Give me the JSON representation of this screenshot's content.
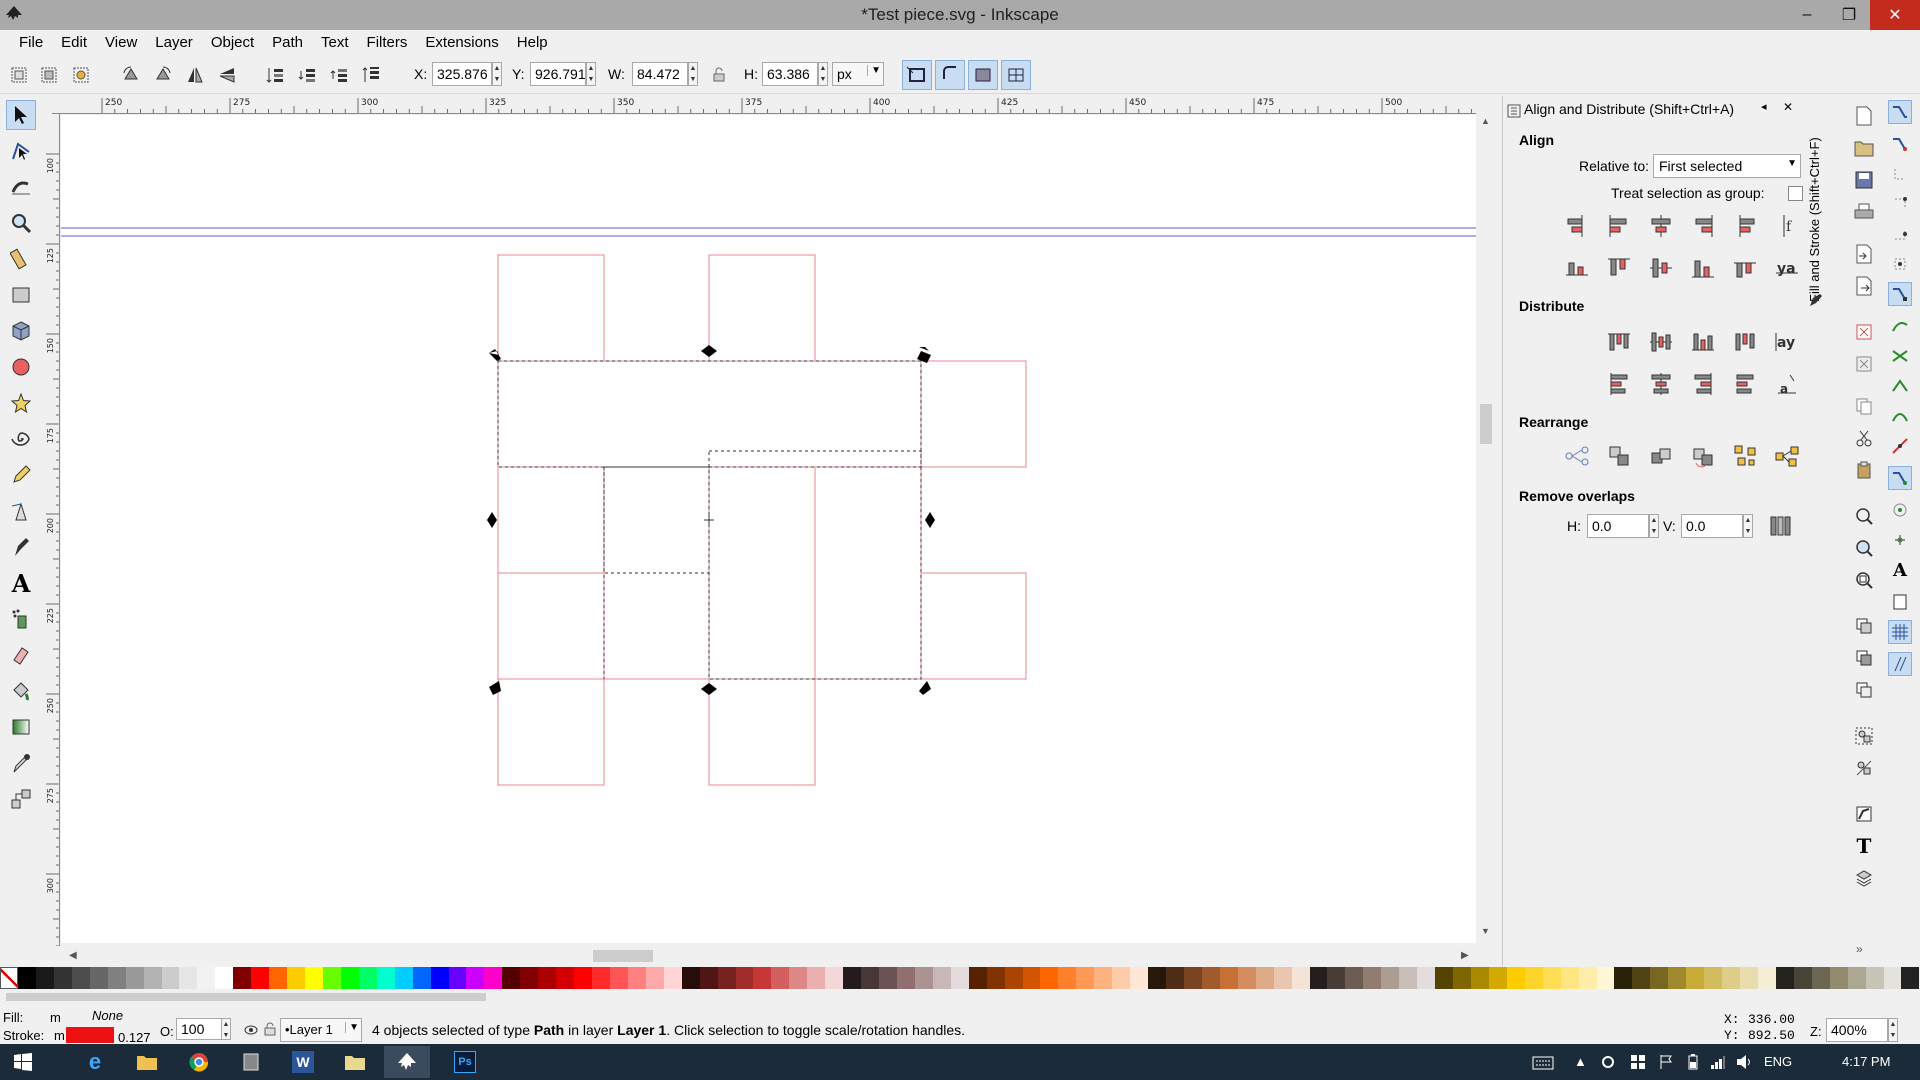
{
  "window": {
    "title": "*Test piece.svg - Inkscape",
    "minimize": "–",
    "maximize": "❐",
    "close": "✕"
  },
  "menu": [
    "File",
    "Edit",
    "View",
    "Layer",
    "Object",
    "Path",
    "Text",
    "Filters",
    "Extensions",
    "Help"
  ],
  "controls": {
    "x_label": "X:",
    "x_value": "325.876",
    "y_label": "Y:",
    "y_value": "926.791",
    "w_label": "W:",
    "w_value": "84.472",
    "h_label": "H:",
    "h_value": "63.386",
    "unit": "px"
  },
  "rulers": {
    "h_ticks": [
      "250",
      "275",
      "300",
      "325",
      "350",
      "375",
      "400",
      "425",
      "450",
      "475",
      "500"
    ],
    "v_ticks": [
      "100",
      "125",
      "150",
      "175",
      "200",
      "225",
      "250",
      "275",
      "300"
    ]
  },
  "dock": {
    "title": "Align and Distribute (Shift+Ctrl+A)",
    "vertical_tab": "Fill and Stroke (Shift+Ctrl+F)",
    "align": {
      "heading": "Align",
      "relative_label": "Relative to:",
      "relative_value": "First selected",
      "treat_group_label": "Treat selection as group:",
      "treat_group_checked": false
    },
    "distribute_heading": "Distribute",
    "rearrange_heading": "Rearrange",
    "remove_overlaps": {
      "heading": "Remove overlaps",
      "h_label": "H:",
      "h_value": "0.0",
      "v_label": "V:",
      "v_value": "0.0"
    }
  },
  "statusbar": {
    "fill_label": "Fill:",
    "fill_value": "m",
    "fill_none": "None",
    "stroke_label": "Stroke:",
    "stroke_value": "m",
    "stroke_width": "0.127",
    "opacity_label": "O:",
    "opacity_value": "100",
    "layer": "•Layer 1",
    "message_parts": [
      "4 objects selected of type ",
      "Path",
      " in layer ",
      "Layer 1",
      ". Click selection to toggle scale/rotation handles."
    ],
    "cursor_x_label": "X:",
    "cursor_x": "336.00",
    "cursor_y_label": "Y:",
    "cursor_y": "892.50",
    "zoom_label": "Z:",
    "zoom": "400%"
  },
  "taskbar": {
    "language": "ENG",
    "time": "4:17 PM"
  },
  "colors": {
    "shape_stroke": "#e8858f",
    "guide": "#5060c8",
    "accent": "#3a78c4",
    "stroke_swatch": "#ee1111"
  }
}
